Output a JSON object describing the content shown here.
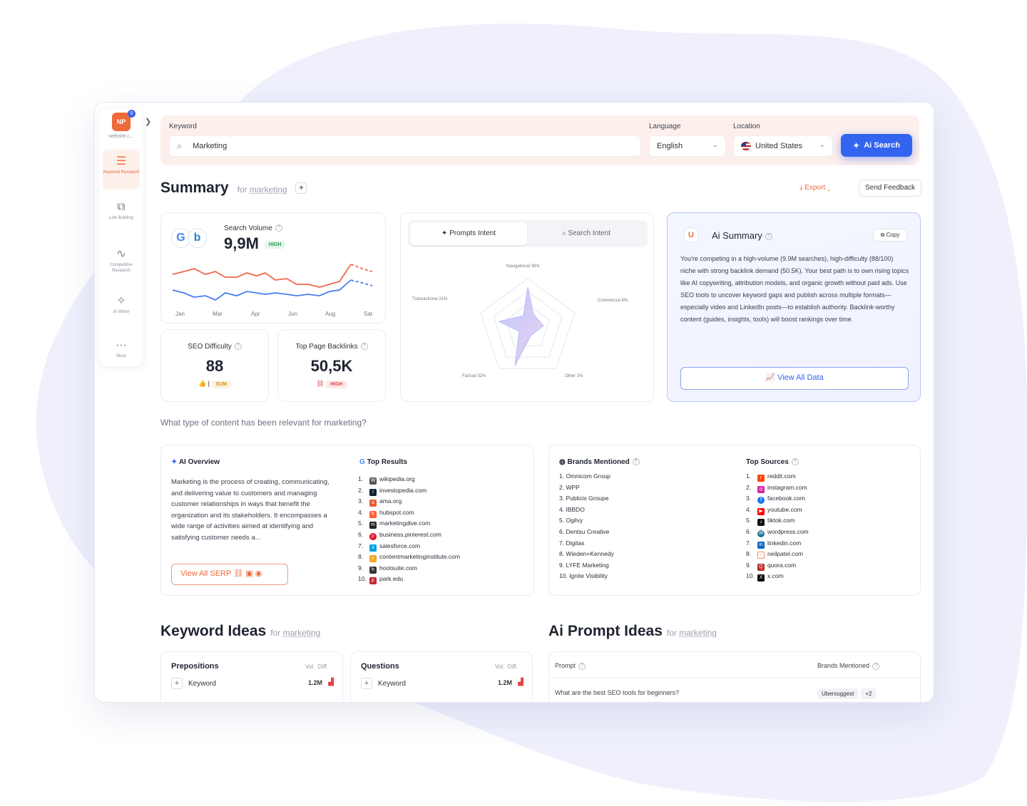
{
  "sidebar": {
    "logo_text": "NP",
    "logo_badge": "0",
    "site": "website.c...",
    "items": [
      {
        "label": "Keyword Research",
        "icon": "keyword-research-icon"
      },
      {
        "label": "Link Building",
        "icon": "link-building-icon"
      },
      {
        "label": "Competitive Research",
        "icon": "competitive-research-icon"
      },
      {
        "label": "AI Writer",
        "icon": "ai-writer-icon"
      },
      {
        "label": "More",
        "icon": "more-icon"
      }
    ]
  },
  "search": {
    "keyword_label": "Keyword",
    "keyword_value": "Marketing",
    "language_label": "Language",
    "language_value": "English",
    "location_label": "Location",
    "location_value": "United States",
    "button": "Ai Search"
  },
  "summary": {
    "title": "Summary",
    "for": "for",
    "term": "marketing",
    "export": "Export",
    "feedback": "Send Feedback"
  },
  "volume": {
    "label": "Search Volume",
    "value": "9,9M",
    "badge": "HIGH",
    "months": [
      "Jan",
      "Mar",
      "Apr",
      "Jun",
      "Aug",
      "Sat"
    ]
  },
  "difficulty": {
    "label": "SEO Difficulty",
    "value": "88",
    "badge": "SUM"
  },
  "backlinks": {
    "label": "Top Page Backlinks",
    "value": "50,5K",
    "badge": "HIGH"
  },
  "intent": {
    "tab_prompts": "Prompts Intent",
    "tab_search": "Search Intent",
    "labels": {
      "navigational": "Navigational 38%",
      "commercial": "Commercial 8%",
      "transactional": "Transactional 21%",
      "factual": "Factual 32%",
      "other": "Other 1%"
    }
  },
  "ai_summary": {
    "title": "Ai Summary",
    "copy": "Copy",
    "text": "You're competing in a high-volume (9.9M searches), high-difficulty (88/100) niche with strong backlink demand (50.5K). Your best path is to own rising topics like AI copywriting, attribution models, and organic growth without paid ads. Use SEO tools to uncover keyword gaps and publish across multiple formats—especially video and LinkedIn posts—to establish authority. Backlink-worthy content (guides, insights, tools) will boost rankings over time.",
    "view_all": "View All Data"
  },
  "question": "What type of content has been relevant for marketing?",
  "overview": {
    "title": "AI Overview",
    "text": "Marketing is the process of creating, communicating, and delivering value to customers and managing customer relationships in ways that benefit the organization and its stakeholders. It encompasses a wide range of activities aimed at identifying and satisfying customer needs a...",
    "serp_button": "View All SERP"
  },
  "top_results": {
    "title": "Top Results",
    "items": [
      "wikipedia.org",
      "investopedia.com",
      "ama.org",
      "hubspot.com",
      "marketingdive.com",
      "business.pinterest.com",
      "salesforce.com",
      "contentmarketinginstitute.com",
      "hootsuite.com",
      "park.edu"
    ]
  },
  "brands": {
    "title": "Brands Mentioned",
    "items": [
      "Omnicom Group",
      "WPP",
      "Publicis Groupe",
      "IBBDO",
      "Ogilvy",
      "Dentsu Creative",
      "Digitas",
      "Wieden+Kennedy",
      "LYFE Marketing",
      "Ignite Visibility"
    ]
  },
  "sources": {
    "title": "Top Sources",
    "items": [
      "reddit.com",
      "instagram.com",
      "facebook.com",
      "youtube.com",
      "tiktok.com",
      "wordpress.com",
      "linkedin.com",
      "neilpatel.com",
      "quora.com",
      "x.com"
    ]
  },
  "keyword_ideas": {
    "title": "Keyword Ideas",
    "for": "for",
    "term": "marketing",
    "vol": "Vol.",
    "diff": "Diff.",
    "prepositions": {
      "title": "Prepositions",
      "row": "Keyword",
      "value": "1.2M"
    },
    "questions": {
      "title": "Questions",
      "row": "Keyword",
      "value": "1.2M"
    }
  },
  "prompt_ideas": {
    "title": "Ai Prompt Ideas",
    "for": "for",
    "term": "marketing",
    "col_prompt": "Prompt",
    "col_brands": "Brands Mentioned",
    "row_text": "What are the best SEO tools for beginners?",
    "row_brand": "Ubersuggest",
    "row_more": "+2"
  },
  "colors": {
    "accent": "#ef6a3a",
    "primary": "#3264f0",
    "chart_red": "#f0674a",
    "chart_blue": "#4a7cf0"
  },
  "chart_data": {
    "type": "line",
    "x": [
      "Jan",
      "Mar",
      "Apr",
      "Jun",
      "Aug",
      "Sat"
    ],
    "series": []
  }
}
